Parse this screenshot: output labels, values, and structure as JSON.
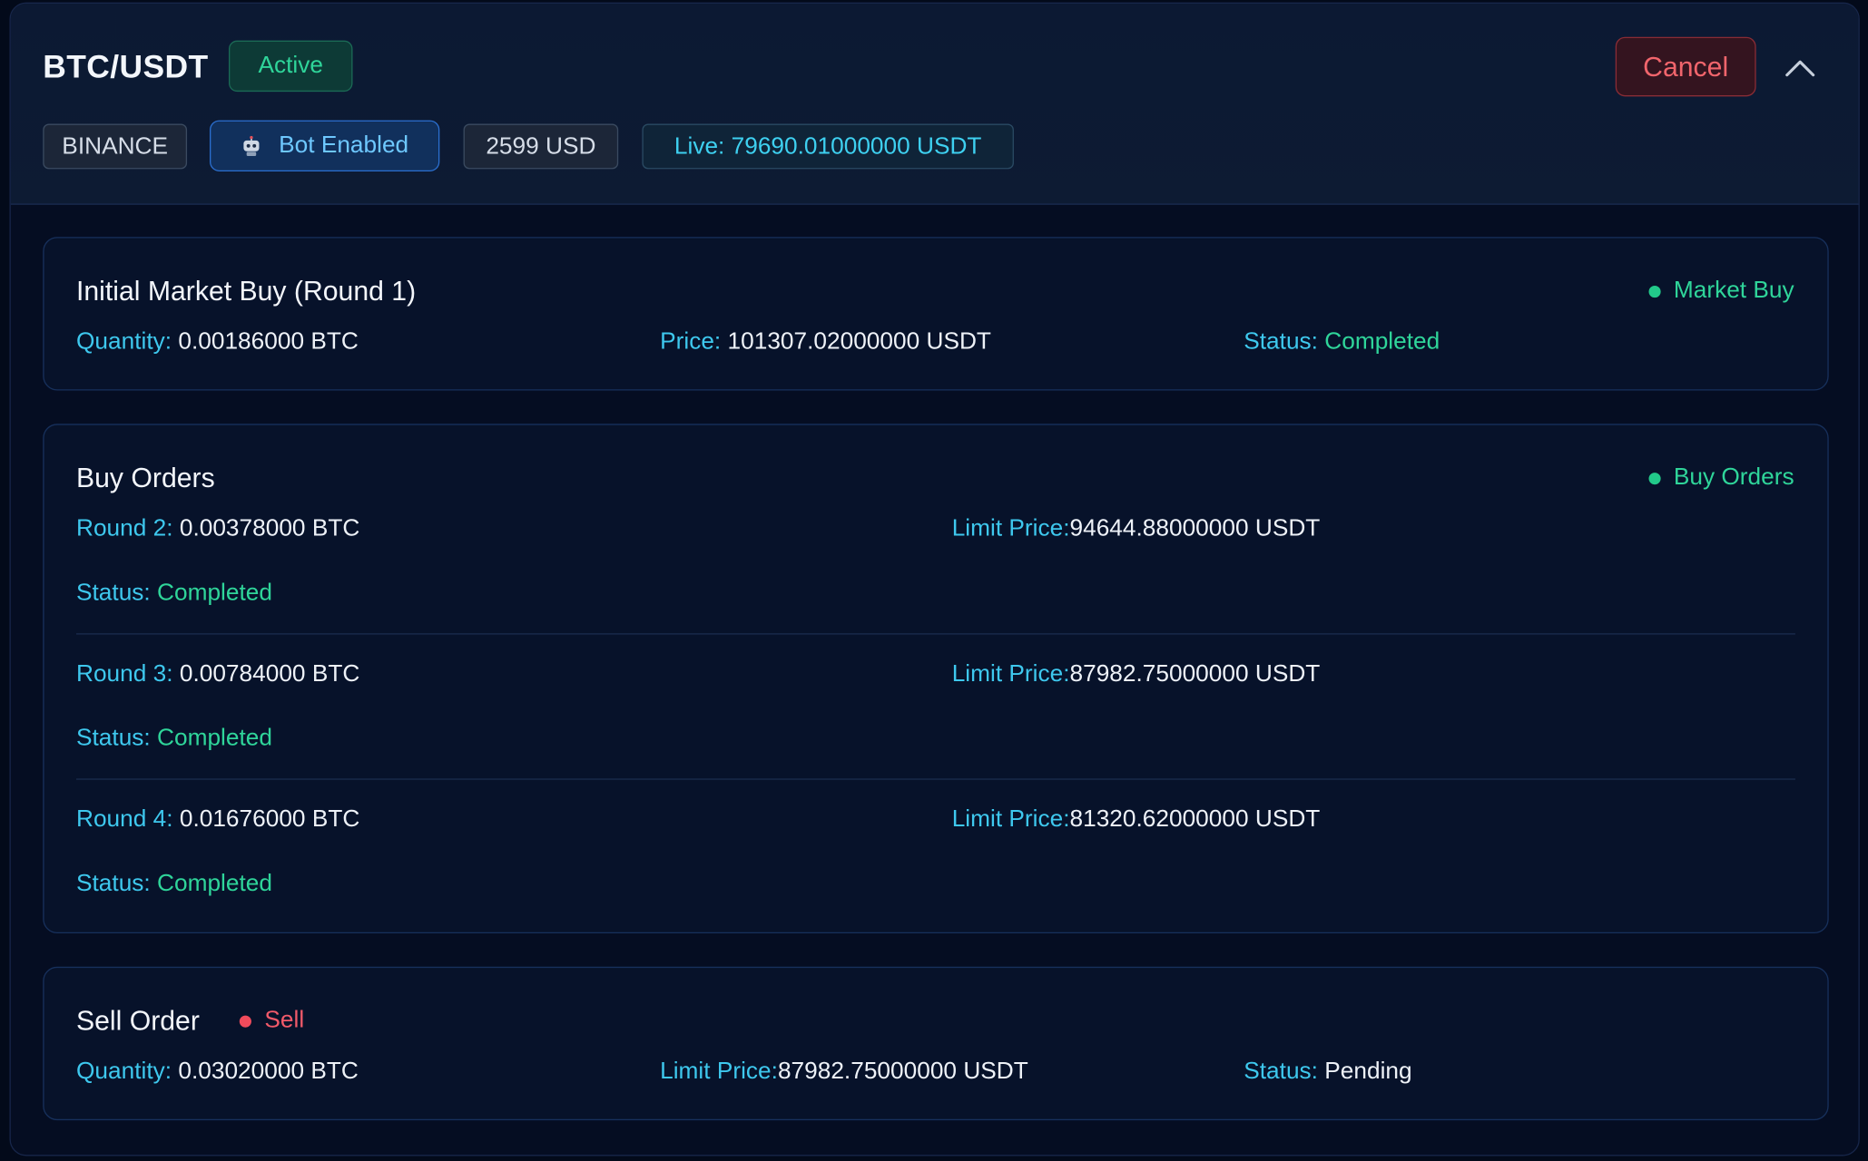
{
  "header": {
    "pair": "BTC/USDT",
    "status": "Active",
    "cancel_label": "Cancel",
    "tags": {
      "exchange": "BINANCE",
      "bot": "Bot Enabled",
      "amount": "2599 USD",
      "live": "Live: 79690.01000000 USDT"
    }
  },
  "initial_buy": {
    "title": "Initial Market Buy (Round 1)",
    "legend": "Market Buy",
    "quantity_label": "Quantity:",
    "quantity_value": "0.00186000 BTC",
    "price_label": "Price:",
    "price_value": "101307.02000000 USDT",
    "status_label": "Status:",
    "status_value": "Completed"
  },
  "buy_orders": {
    "title": "Buy Orders",
    "legend": "Buy Orders",
    "rounds": [
      {
        "round_label": "Round 2:",
        "qty": "0.00378000 BTC",
        "limit_label": "Limit Price:",
        "limit_value": "94644.88000000 USDT",
        "status_label": "Status:",
        "status_value": "Completed"
      },
      {
        "round_label": "Round 3:",
        "qty": "0.00784000 BTC",
        "limit_label": "Limit Price:",
        "limit_value": "87982.75000000 USDT",
        "status_label": "Status:",
        "status_value": "Completed"
      },
      {
        "round_label": "Round 4:",
        "qty": "0.01676000 BTC",
        "limit_label": "Limit Price:",
        "limit_value": "81320.62000000 USDT",
        "status_label": "Status:",
        "status_value": "Completed"
      }
    ]
  },
  "sell_order": {
    "title": "Sell Order",
    "legend": "Sell",
    "quantity_label": "Quantity:",
    "quantity_value": "0.03020000 BTC",
    "limit_label": "Limit Price:",
    "limit_value": "87982.75000000 USDT",
    "status_label": "Status:",
    "status_value": "Pending"
  },
  "colors": {
    "background": "#030a1a",
    "accent_cyan": "#3ec8ee",
    "success_green": "#2fd59a",
    "danger_red": "#f1656c"
  }
}
